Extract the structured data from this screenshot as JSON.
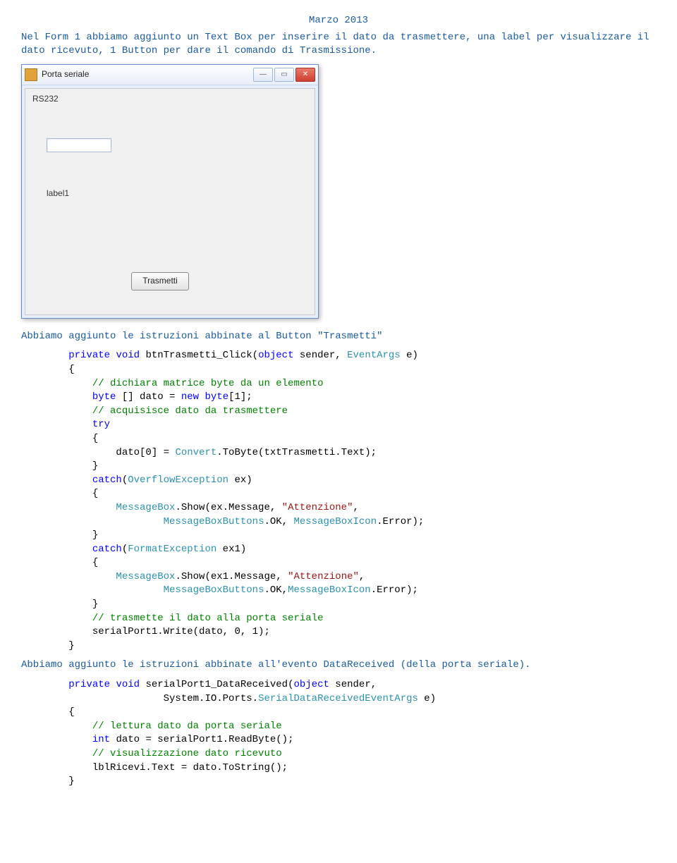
{
  "header_date": "Marzo 2013",
  "intro": "Nel Form 1 abbiamo aggiunto un Text Box per inserire il dato da trasmettere, una label per visualizzare il dato ricevuto, 1 Button per dare il comando di Trasmissione.",
  "window": {
    "title": "Porta seriale",
    "groupbox": "RS232",
    "label1": "label1",
    "button": "Trasmetti"
  },
  "para1_prefix": "Abbiamo aggiunto le istruzioni abbinate al Button \"Trasmetti\"",
  "code1": {
    "l1a": "private",
    "l1b": "void",
    "l1c": " btnTrasmetti_Click(",
    "l1d": "object",
    "l1e": " sender, ",
    "l1f": "EventArgs",
    "l1g": " e)",
    "l2": "        {",
    "l3": "            // dichiara matrice byte da un elemento",
    "l4a": "            ",
    "l4b": "byte",
    "l4c": " [] dato = ",
    "l4d": "new",
    "l4e": " ",
    "l4f": "byte",
    "l4g": "[1];",
    "l5": "            // acquisisce dato da trasmettere",
    "l6": "            try",
    "l7": "            {",
    "l8a": "                dato[0] = ",
    "l8b": "Convert",
    "l8c": ".ToByte(txtTrasmetti.Text);",
    "l9": "            }",
    "l10a": "            ",
    "l10b": "catch",
    "l10c": "(",
    "l10d": "OverflowException",
    "l10e": " ex)",
    "l11": "            {",
    "l12a": "                ",
    "l12b": "MessageBox",
    "l12c": ".Show(ex.Message, ",
    "l12d": "\"Attenzione\"",
    "l12e": ",",
    "l13a": "                        ",
    "l13b": "MessageBoxButtons",
    "l13c": ".OK, ",
    "l13d": "MessageBoxIcon",
    "l13e": ".Error);",
    "l14": "            }",
    "l15a": "            ",
    "l15b": "catch",
    "l15c": "(",
    "l15d": "FormatException",
    "l15e": " ex1)",
    "l16": "            {",
    "l17a": "                ",
    "l17b": "MessageBox",
    "l17c": ".Show(ex1.Message, ",
    "l17d": "\"Attenzione\"",
    "l17e": ",",
    "l18a": "                        ",
    "l18b": "MessageBoxButtons",
    "l18c": ".OK,",
    "l18d": "MessageBoxIcon",
    "l18e": ".Error);",
    "l19": "            }",
    "l20": "            // trasmette il dato alla porta seriale",
    "l21": "            serialPort1.Write(dato, 0, 1);",
    "l22": "        }"
  },
  "para2": "Abbiamo aggiunto le istruzioni abbinate all'evento DataReceived (della porta seriale).",
  "code2": {
    "l1a": "        ",
    "l1b": "private",
    "l1c": " ",
    "l1d": "void",
    "l1e": " serialPort1_DataReceived(",
    "l1f": "object",
    "l1g": " sender,",
    "l2a": "                        System.IO.Ports.",
    "l2b": "SerialDataReceivedEventArgs",
    "l2c": " e)",
    "l3": "        {",
    "l4": "            // lettura dato da porta seriale",
    "l5a": "            ",
    "l5b": "int",
    "l5c": " dato = serialPort1.ReadByte();",
    "l6": "            // visualizzazione dato ricevuto",
    "l7": "            lblRicevi.Text = dato.ToString();",
    "l8": "        }"
  }
}
